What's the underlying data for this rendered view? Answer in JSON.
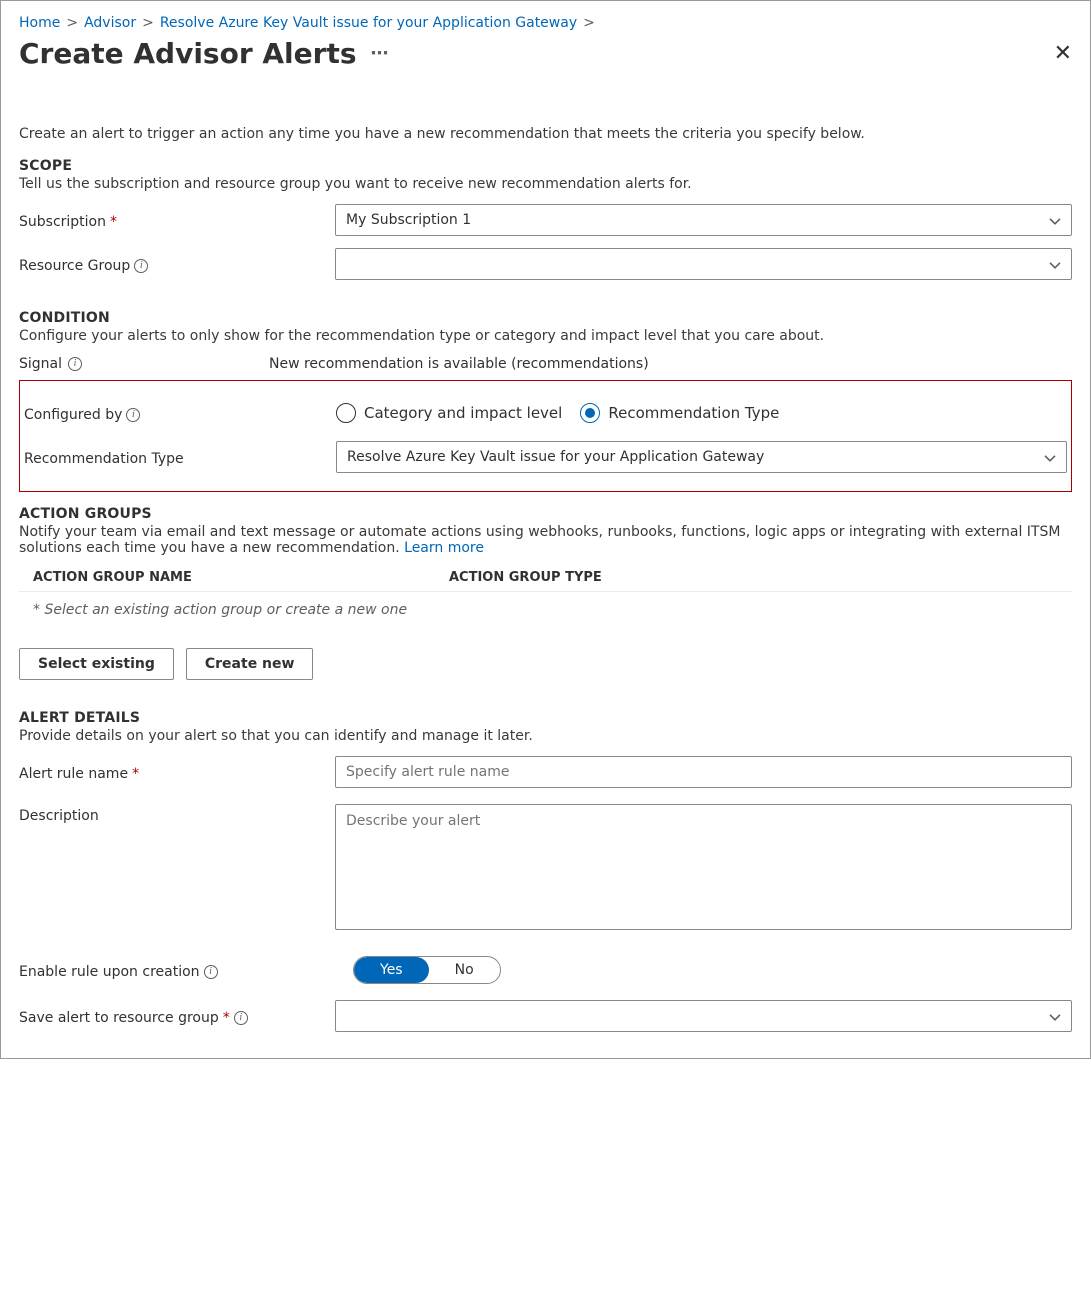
{
  "breadcrumb": {
    "home": "Home",
    "advisor": "Advisor",
    "resolve": "Resolve Azure Key Vault issue for your Application Gateway"
  },
  "page_title": "Create Advisor Alerts",
  "intro": "Create an alert to trigger an action any time you have a new recommendation that meets the criteria you specify below.",
  "scope": {
    "heading": "SCOPE",
    "desc": "Tell us the subscription and resource group you want to receive new recommendation alerts for.",
    "subscription_label": "Subscription",
    "subscription_value": "My Subscription 1",
    "resource_group_label": "Resource Group",
    "resource_group_value": ""
  },
  "condition": {
    "heading": "CONDITION",
    "desc": "Configure your alerts to only show for the recommendation type or category and impact level that you care about.",
    "signal_label": "Signal",
    "signal_value": "New recommendation is available (recommendations)",
    "configured_by_label": "Configured by",
    "radio_category": "Category and impact level",
    "radio_rectype": "Recommendation Type",
    "rectype_label": "Recommendation Type",
    "rectype_value": "Resolve Azure Key Vault issue for your Application Gateway"
  },
  "action_groups": {
    "heading": "ACTION GROUPS",
    "desc": "Notify your team via email and text message or automate actions using webhooks, runbooks, functions, logic apps or integrating with external ITSM solutions each time you have a new recommendation. ",
    "learn_more": "Learn more",
    "col_name": "ACTION GROUP NAME",
    "col_type": "ACTION GROUP TYPE",
    "placeholder": "* Select an existing action group or create a new one",
    "btn_select": "Select existing",
    "btn_create": "Create new"
  },
  "alert_details": {
    "heading": "ALERT DETAILS",
    "desc": "Provide details on your alert so that you can identify and manage it later.",
    "name_label": "Alert rule name",
    "name_placeholder": "Specify alert rule name",
    "desc_label": "Description",
    "desc_placeholder": "Describe your alert",
    "enable_label": "Enable rule upon creation",
    "toggle_yes": "Yes",
    "toggle_no": "No",
    "save_label": "Save alert to resource group",
    "save_value": ""
  }
}
